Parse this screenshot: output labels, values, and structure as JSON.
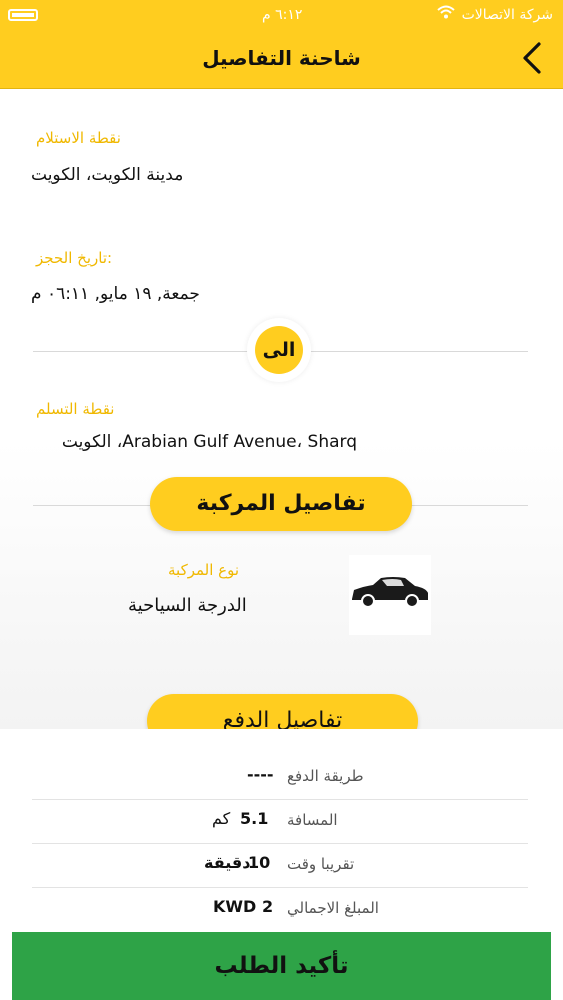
{
  "status_bar": {
    "carrier": "شركة الاتصالات",
    "time": "٦:١٢ م"
  },
  "header": {
    "title": "شاحنة التفاصيل"
  },
  "pickup": {
    "label": "نقطة الاستلام",
    "value": "مدينة الكويت، الكويت"
  },
  "booking_date": {
    "label": "تاريخ الحجز:",
    "value": "جمعة, ١٩ مايو, ٠٦:١١ م"
  },
  "to_badge": "الى",
  "dropoff": {
    "label": "نقطة التسلم",
    "value": "Arabian Gulf Avenue، Sharq، الكويت"
  },
  "vehicle_section": {
    "title": "تفاصيل المركبة",
    "type_label": "نوع المركبة",
    "type_value": "الدرجة السياحية",
    "icon": "car-icon"
  },
  "payment_section": {
    "title": "تفاصيل الدفع",
    "rows": [
      {
        "label": "طريقة الدفع",
        "number": "----",
        "unit": ""
      },
      {
        "label": "المسافة",
        "number": "5.1",
        "unit": "كم"
      },
      {
        "label": "تقريبا وقت",
        "number": "10",
        "unit": "دقيقة"
      },
      {
        "label": "المبلغ الاجمالي",
        "number": "2",
        "unit": "KWD"
      }
    ]
  },
  "confirm_button": "تأكيد الطلب",
  "colors": {
    "accent": "#ffcd1f",
    "label": "#f0b800",
    "confirm": "#2ea347"
  }
}
